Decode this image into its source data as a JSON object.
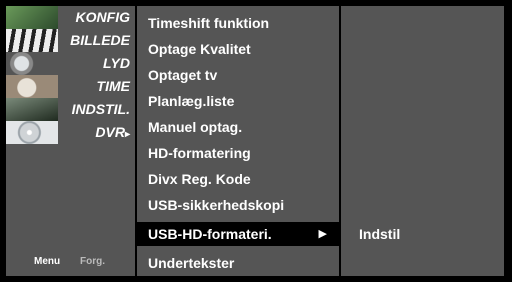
{
  "categories": [
    {
      "label": "KONFIG",
      "icon": "config-thumb-icon",
      "bg": "#3a6b3a"
    },
    {
      "label": "BILLEDE",
      "icon": "picture-thumb-icon",
      "bg": "#d9d9d9"
    },
    {
      "label": "LYD",
      "icon": "audio-thumb-icon",
      "bg": "#9aa0a6"
    },
    {
      "label": "TIME",
      "icon": "clock-thumb-icon",
      "bg": "#b0a090"
    },
    {
      "label": "INDSTIL.",
      "icon": "special-thumb-icon",
      "bg": "#2d3a2d"
    },
    {
      "label": "DVR",
      "icon": "disc-thumb-icon",
      "bg": "#cfd3d6"
    }
  ],
  "active_category_arrow": "▸",
  "legend": {
    "menu": "Menu",
    "back": "Forg."
  },
  "menu_items": [
    "Timeshift funktion",
    "Optage Kvalitet",
    "Optaget tv",
    "Planlæg.liste",
    "Manuel optag.",
    "HD-formatering",
    "Divx Reg. Kode",
    "USB-sikkerhedskopi",
    "USB-HD-formateri.",
    "Undertekster"
  ],
  "selected_index": 8,
  "selected_arrow": "▶",
  "submenu": {
    "label": "Indstil"
  },
  "colors": {
    "panel": "#555555",
    "highlight": "#000000",
    "text": "#ffffff"
  }
}
